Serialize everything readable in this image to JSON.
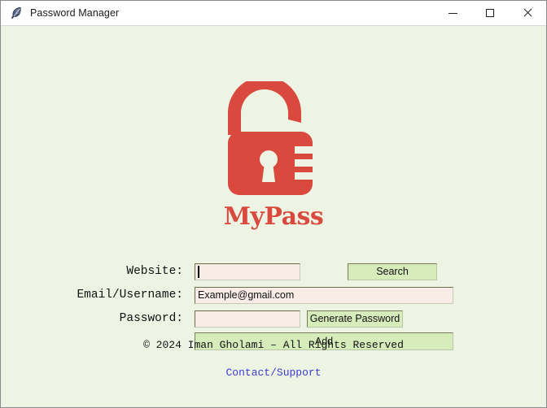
{
  "window": {
    "title": "Password Manager",
    "icon": "feather-icon",
    "background_color": "#eef4e3",
    "controls": {
      "minimize": "minimize-button",
      "maximize": "maximize-button",
      "close": "close-button"
    }
  },
  "logo": {
    "icon": "open-padlock-icon",
    "wordmark": "MyPass",
    "color": "#d9493d"
  },
  "form": {
    "website": {
      "label": "Website:",
      "value": "",
      "placeholder": "",
      "focused": true
    },
    "email": {
      "label": "Email/Username:",
      "value": "Example@gmail.com",
      "placeholder": ""
    },
    "password": {
      "label": "Password:",
      "value": "",
      "placeholder": ""
    },
    "buttons": {
      "search": "Search",
      "generate": "Generate Password",
      "add": "Add"
    },
    "field_background_color": "#f8ece6",
    "button_background_color": "#d6ecba"
  },
  "footer": {
    "copyright": "© 2024 Iman Gholami – All Rights Reserved",
    "support_link": "Contact/Support",
    "link_color": "#3b3bd6"
  }
}
